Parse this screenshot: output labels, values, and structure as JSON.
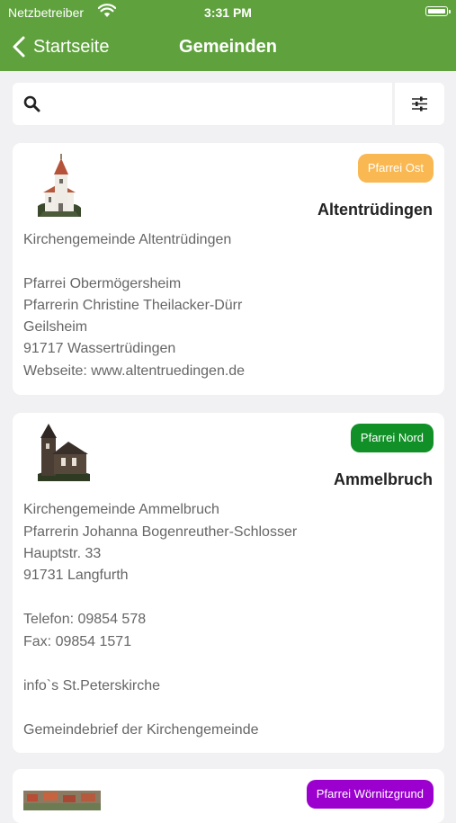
{
  "status_bar": {
    "carrier": "Netzbetreiber",
    "time": "3:31 PM"
  },
  "nav": {
    "back_label": "Startseite",
    "title": "Gemeinden"
  },
  "search": {
    "placeholder": "",
    "value": ""
  },
  "colors": {
    "header": "#5fa23d",
    "badge_ost": "#f9b851",
    "badge_nord": "#119028",
    "badge_woernitz": "#9b00cf"
  },
  "cards": [
    {
      "badge": "Pfarrei Ost",
      "name": "Altentrüdingen",
      "lines": [
        "Kirchengemeinde Altentrüdingen",
        "",
        "Pfarrei Obermögersheim",
        "Pfarrerin Christine Theilacker-Dürr",
        "Geilsheim",
        "91717 Wassertrüdingen",
        "Webseite: www.altentruedingen.de"
      ]
    },
    {
      "badge": "Pfarrei Nord",
      "name": "Ammelbruch",
      "lines": [
        "Kirchengemeinde Ammelbruch",
        "Pfarrerin Johanna Bogenreuther-Schlosser",
        "Hauptstr. 33",
        "91731 Langfurth",
        "",
        "Telefon: 09854 578",
        "Fax: 09854 1571",
        "",
        "info`s St.Peterskirche",
        "",
        "Gemeindebrief der Kirchengemeinde"
      ]
    },
    {
      "badge": "Pfarrei Wörnitzgrund"
    }
  ]
}
